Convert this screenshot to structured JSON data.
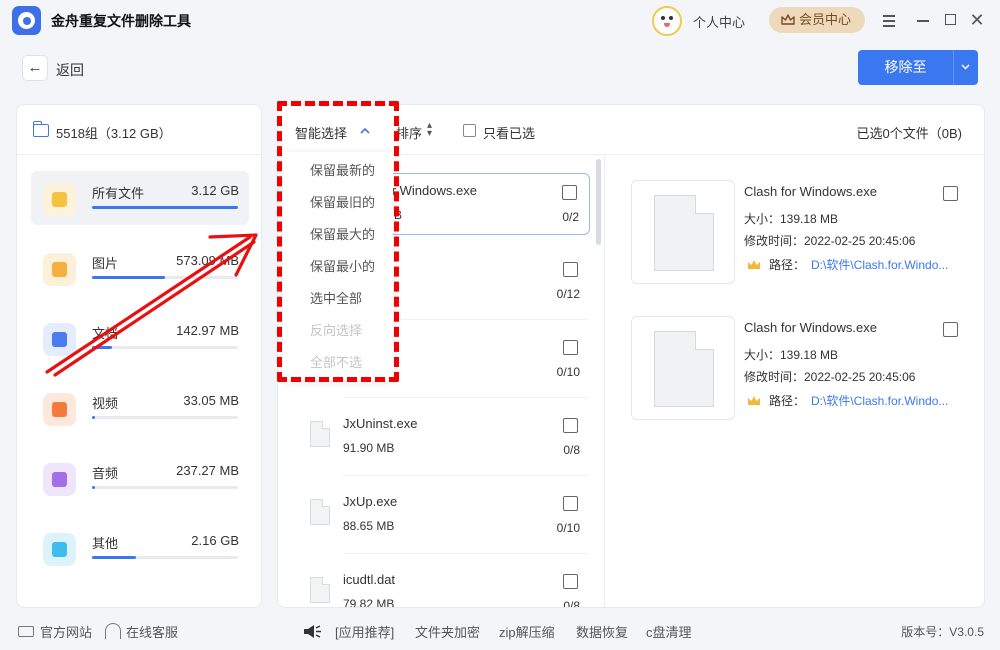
{
  "app": {
    "title": "金舟重复文件删除工具"
  },
  "header": {
    "personal_center": "个人中心",
    "vip_center": "会员中心"
  },
  "nav": {
    "back_label": "返回"
  },
  "actions": {
    "move_to": "移除至"
  },
  "group": {
    "title": "5518组（3.12 GB）"
  },
  "categories": [
    {
      "name": "所有文件",
      "size": "3.12 GB",
      "icon": "folder-icon",
      "color": "#f6c341",
      "bg": "#fdf3dc",
      "progress": 1.0
    },
    {
      "name": "图片",
      "size": "573.09 MB",
      "icon": "image-icon",
      "color": "#f4b13d",
      "bg": "#fdf0d8",
      "progress": 0.5
    },
    {
      "name": "文档",
      "size": "142.97 MB",
      "icon": "document-icon",
      "color": "#4a7cf0",
      "bg": "#e4ecfd",
      "progress": 0.14
    },
    {
      "name": "视频",
      "size": "33.05 MB",
      "icon": "video-icon",
      "color": "#f57a3d",
      "bg": "#fde8dc",
      "progress": 0.02
    },
    {
      "name": "音频",
      "size": "237.27 MB",
      "icon": "audio-icon",
      "color": "#a36ee8",
      "bg": "#efe5fc",
      "progress": 0.02
    },
    {
      "name": "其他",
      "size": "2.16 GB",
      "icon": "other-icon",
      "color": "#3cbdee",
      "bg": "#ddf3fc",
      "progress": 0.3
    }
  ],
  "toolbar": {
    "smart_select": "智能选择",
    "sort": "排序",
    "only_selected": "只看已选",
    "selected_count": "已选0个文件（0B)"
  },
  "dropdown": [
    "保留最新的",
    "保留最旧的",
    "保留最大的",
    "保留最小的",
    "选中全部",
    "反向选择",
    "全部不选"
  ],
  "files": [
    {
      "name": "Clash for Windows.exe",
      "size": "139.18 MB",
      "count": "0/2"
    },
    {
      "name": "",
      "size": "",
      "count": "0/12"
    },
    {
      "name": "",
      "size": "",
      "count": "0/10"
    },
    {
      "name": "JxUninst.exe",
      "size": "91.90 MB",
      "count": "0/8"
    },
    {
      "name": "JxUp.exe",
      "size": "88.65 MB",
      "count": "0/10"
    },
    {
      "name": "icudtl.dat",
      "size": "79.82 MB",
      "count": "0/8"
    }
  ],
  "details": [
    {
      "name": "Clash for Windows.exe",
      "size": "大小：139.18 MB",
      "time": "修改时间：2022-02-25 20:45:06",
      "path_label": "路径：",
      "path": "D:\\软件\\Clash.for.Windo..."
    },
    {
      "name": "Clash for Windows.exe",
      "size": "大小：139.18 MB",
      "time": "修改时间：2022-02-25 20:45:06",
      "path_label": "路径：",
      "path": "D:\\软件\\Clash.for.Windo..."
    }
  ],
  "footer": {
    "official_site": "官方网站",
    "online_service": "在线客服",
    "recommend": "[应用推荐]",
    "links": [
      "文件夹加密",
      "zip解压缩",
      "数据恢复",
      "c盘清理"
    ],
    "version": "版本号：V3.0.5"
  }
}
